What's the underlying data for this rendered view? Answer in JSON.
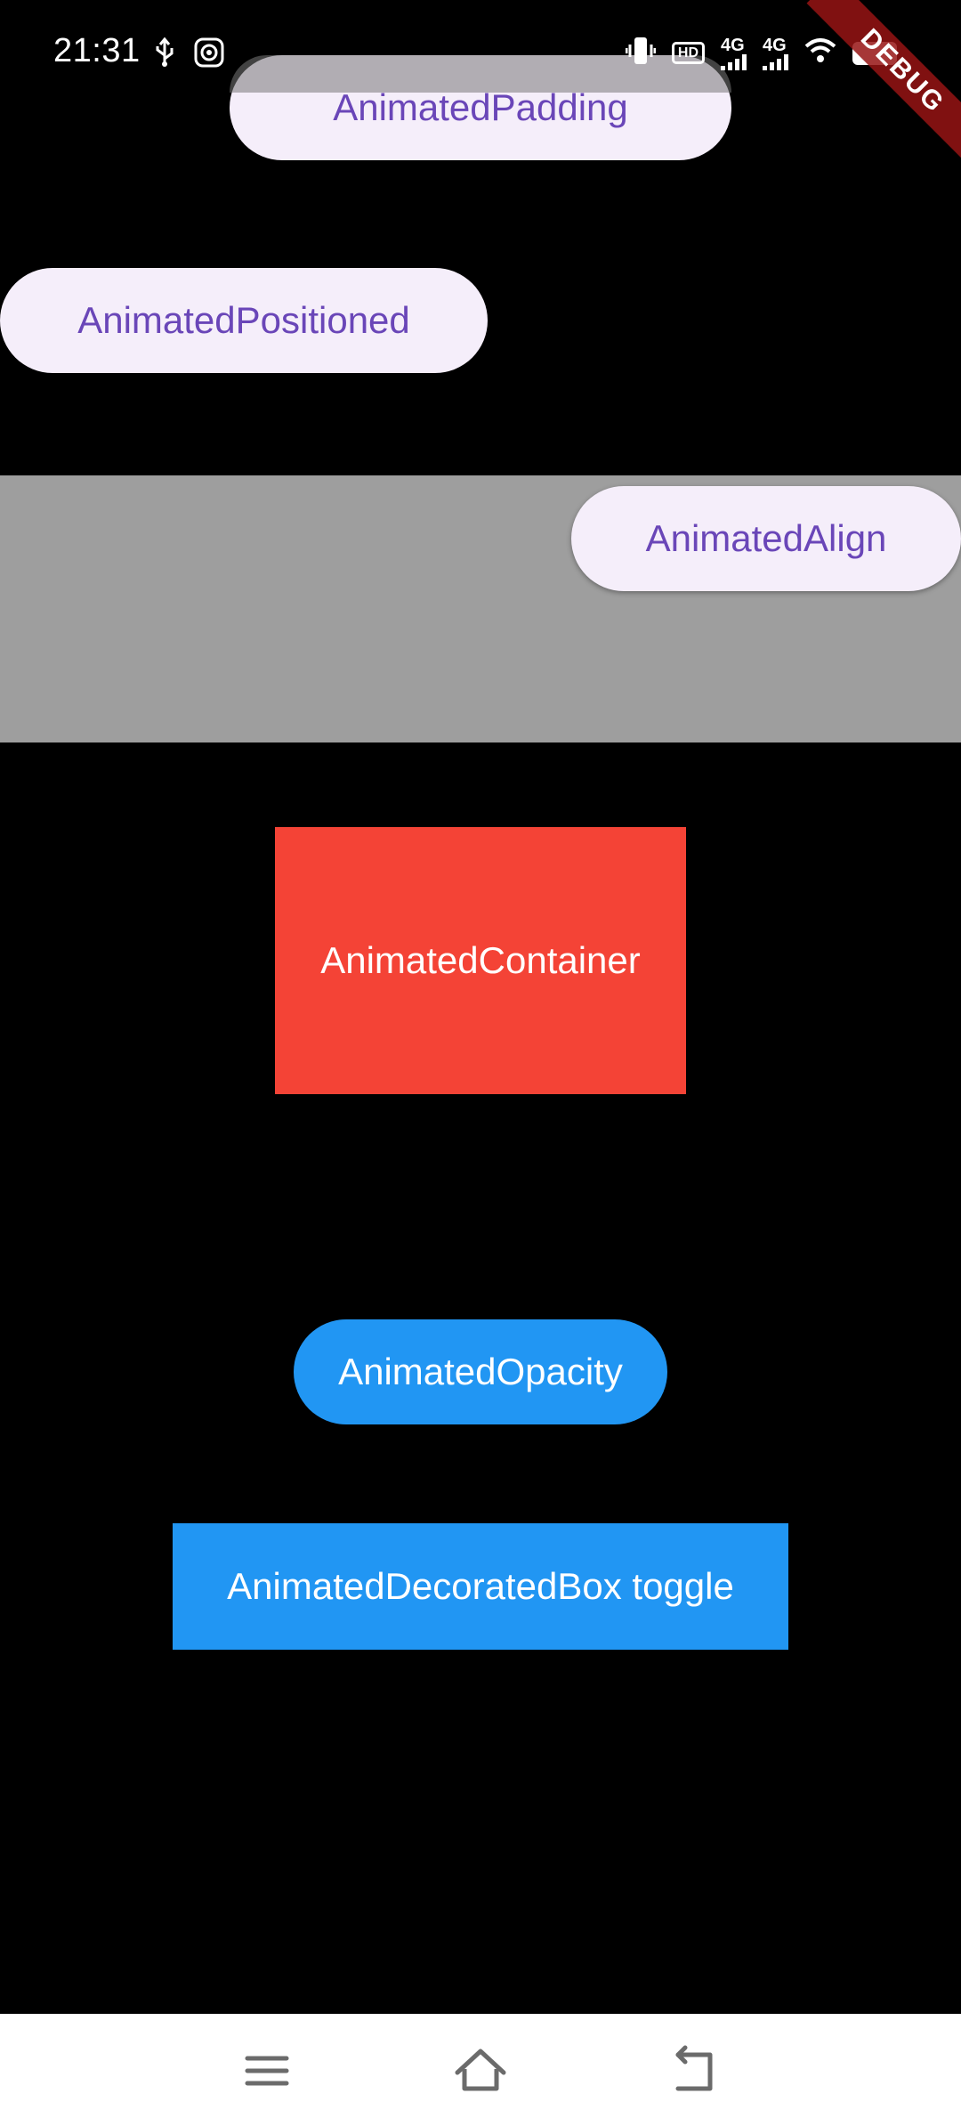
{
  "status_bar": {
    "time": "21:31",
    "hd_label": "HD",
    "network_1": "4G",
    "network_2": "4G"
  },
  "debug_banner": {
    "label": "DEBUG",
    "color": "#961414"
  },
  "buttons": {
    "animated_padding": "AnimatedPadding",
    "animated_positioned": "AnimatedPositioned",
    "animated_align": "AnimatedAlign",
    "animated_opacity": "AnimatedOpacity"
  },
  "animated_container": {
    "label": "AnimatedContainer",
    "color": "#f44336"
  },
  "decorated_box": {
    "label": "AnimatedDecoratedBox toggle",
    "color": "#2196f3"
  },
  "colors": {
    "background": "#000000",
    "pill_background": "#f5eefa",
    "pill_text": "#6a46b8",
    "align_area": "#9e9e9e",
    "opacity_button": "#2196f3"
  },
  "nav_bar": {
    "icons": [
      "menu-icon",
      "home-icon",
      "back-icon"
    ]
  }
}
